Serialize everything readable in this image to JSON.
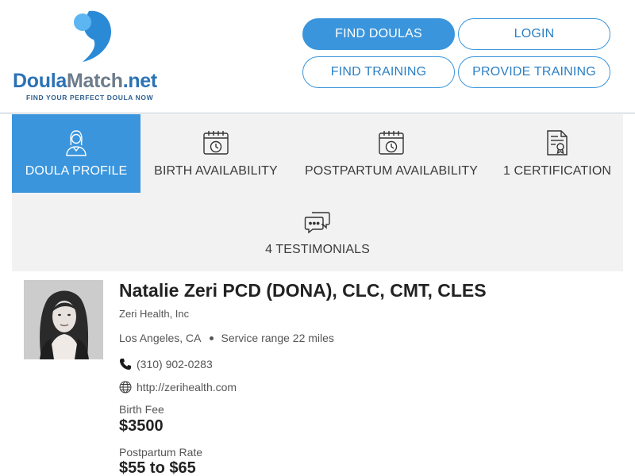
{
  "brand": {
    "name_part1": "Doula",
    "name_part2": "Match",
    "name_part3": ".net",
    "tagline": "FIND YOUR PERFECT DOULA NOW",
    "colors": {
      "primary": "#3a95dc",
      "dark_blue": "#2b72b5",
      "gray": "#6d7c8c"
    }
  },
  "nav": {
    "find_doulas": "FIND DOULAS",
    "login": "LOGIN",
    "find_training": "FIND TRAINING",
    "provide_training": "PROVIDE TRAINING"
  },
  "tabs": [
    {
      "label": "DOULA PROFILE",
      "icon": "person-icon",
      "active": true
    },
    {
      "label": "BIRTH AVAILABILITY",
      "icon": "calendar-clock-icon",
      "active": false
    },
    {
      "label": "POSTPARTUM AVAILABILITY",
      "icon": "calendar-clock-icon",
      "active": false
    },
    {
      "label": "1 CERTIFICATION",
      "icon": "certificate-icon",
      "active": false
    },
    {
      "label": "4 TESTIMONIALS",
      "icon": "chat-bubbles-icon",
      "active": false
    }
  ],
  "profile": {
    "name": "Natalie Zeri PCD (DONA), CLC, CMT, CLES",
    "company": "Zeri Health, Inc",
    "location": "Los Angeles, CA",
    "service_range": "Service range 22 miles",
    "phone": "(310) 902-0283",
    "website": "http://zerihealth.com",
    "birth_fee_label": "Birth Fee",
    "birth_fee": "$3500",
    "postpartum_rate_label": "Postpartum Rate",
    "postpartum_rate": "$55 to $65"
  }
}
